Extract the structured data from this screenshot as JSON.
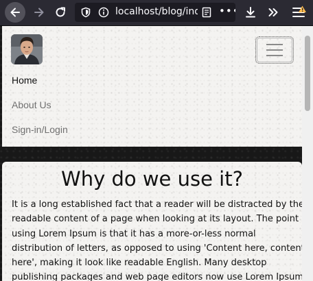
{
  "browser": {
    "url": "localhost/blog/inde",
    "icons": {
      "back": "arrow-left-icon",
      "forward": "arrow-right-icon",
      "reload": "reload-icon",
      "tracking": "shield-icon",
      "site_info": "info-icon",
      "reader": "reader-view-icon",
      "page_actions": "more-horizontal-icon",
      "downloads": "download-icon",
      "overflow": "chevron-double-right-icon",
      "menu": "hamburger-icon"
    },
    "colors": {
      "toolbar": "#2b2a33",
      "urlbar": "#1c1b22",
      "warning": "#ffbd4f"
    }
  },
  "navbar": {
    "links": {
      "home": "Home",
      "about": "About Us",
      "signin": "Sign-in/Login"
    },
    "toggler_icon": "hamburger-icon"
  },
  "article": {
    "title": "Why do we use it?",
    "lines": [
      "It is a long established fact that a reader will be distracted by the",
      "readable content of a page when looking at its layout. The point of",
      "using Lorem Ipsum is that it has a more-or-less normal",
      "distribution of letters, as opposed to using 'Content here, content",
      "here', making it look like readable English. Many desktop",
      "publishing packages and web page editors now use Lorem Ipsum"
    ]
  }
}
